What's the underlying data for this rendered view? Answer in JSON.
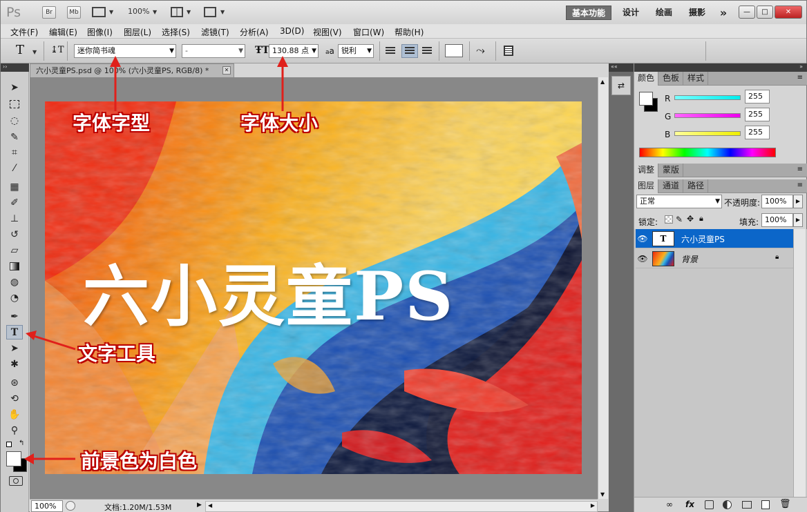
{
  "app": {
    "logo": "Ps",
    "zoom_top": "100%"
  },
  "titlebar": {
    "bridge": "Br",
    "minibridge": "Mb",
    "workspaces": [
      "基本功能",
      "设计",
      "绘画",
      "摄影"
    ],
    "more": "»",
    "controls": [
      "—",
      "□",
      "✕"
    ]
  },
  "menu": [
    "文件(F)",
    "编辑(E)",
    "图像(I)",
    "图层(L)",
    "选择(S)",
    "滤镜(T)",
    "分析(A)",
    "3D(D)",
    "视图(V)",
    "窗口(W)",
    "帮助(H)"
  ],
  "options": {
    "tool_glyph": "T",
    "font_family": "迷你简书魂",
    "font_style": "-",
    "font_size": "130.88 点",
    "aa_label": "a",
    "aa_mode": "锐利"
  },
  "document": {
    "tab_title": "六小灵童PS.psd @ 100% (六小灵童PS, RGB/8) *",
    "close": "✕",
    "canvas_text": "六小灵童PS"
  },
  "status": {
    "zoom": "100%",
    "doc_info": "文档:1.20M/1.53M"
  },
  "color_panel": {
    "tabs": [
      "颜色",
      "色板",
      "样式"
    ],
    "channels": [
      {
        "label": "R",
        "value": "255",
        "color": "#00e6e6"
      },
      {
        "label": "G",
        "value": "255",
        "color": "#e600e6"
      },
      {
        "label": "B",
        "value": "255",
        "color": "#f2f200"
      }
    ]
  },
  "adjust_panel": {
    "tabs": [
      "调整",
      "蒙版"
    ]
  },
  "layers_panel": {
    "tabs": [
      "图层",
      "通道",
      "路径"
    ],
    "blend_mode": "正常",
    "opacity_label": "不透明度:",
    "opacity": "100%",
    "lock_label": "锁定:",
    "fill_label": "填充:",
    "fill": "100%",
    "layers": [
      {
        "name": "六小灵童PS",
        "type": "text",
        "thumb": "T",
        "selected": true
      },
      {
        "name": "背景",
        "type": "image",
        "selected": false
      }
    ],
    "footer_icons": [
      "link-icon",
      "fx-icon",
      "mask-icon",
      "adjustment-icon",
      "group-icon",
      "new-layer-icon",
      "trash-icon"
    ]
  },
  "annotations": {
    "font_type": "字体字型",
    "font_size": "字体大小",
    "text_tool": "文字工具",
    "foreground": "前景色为白色"
  },
  "colors": {
    "annotation_red": "#e0201b",
    "selection_blue": "#0b66c9"
  }
}
